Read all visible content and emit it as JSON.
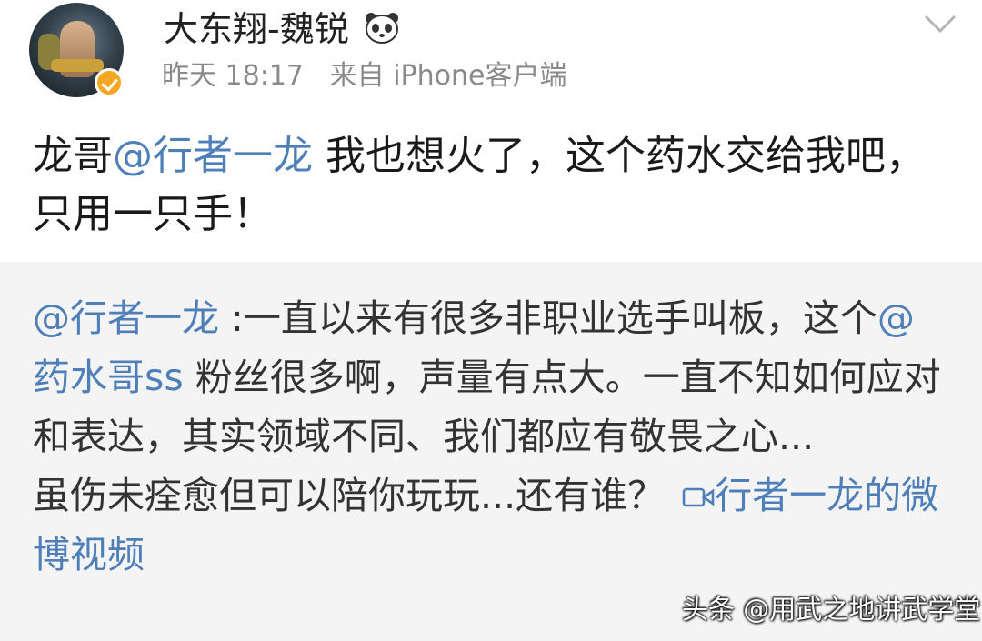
{
  "header": {
    "username": "大东翔-魏锐",
    "time": "昨天 18:17",
    "source_prefix": "来自",
    "source_client": "iPhone客户端"
  },
  "post": {
    "prefix": "龙哥",
    "mention": "@行者一龙",
    "text": " 我也想火了，这个药水交给我吧，只用一只手！"
  },
  "quote": {
    "mention": "@行者一龙",
    "text_1": " :一直以来有很多非职业选手叫板，这个",
    "mention_2": "@药水哥ss",
    "text_2": " 粉丝很多啊，声量有点大。一直不知如何应对和表达，其实领域不同、我们都应有敬畏之心...",
    "text_3": "虽伤未痊愈但可以陪你玩玩...还有谁？ ",
    "video_link": "行者一龙的微博视频"
  },
  "watermark": "头条 @用武之地讲武学堂",
  "colors": {
    "link": "#4f7fb8",
    "quote_background": "#f4f4f4",
    "verified_badge": "#f5a623"
  },
  "icons": [
    "panda-icon",
    "verified-badge-icon",
    "chevron-down-icon",
    "video-icon"
  ]
}
